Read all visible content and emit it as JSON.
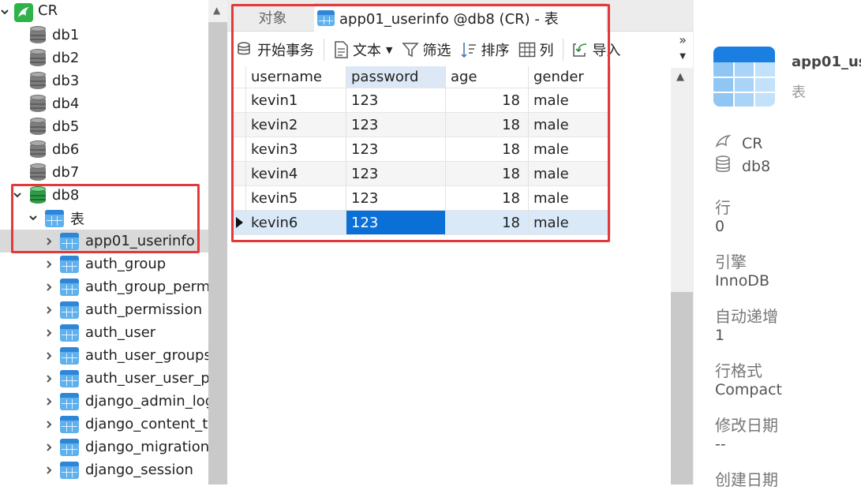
{
  "tree": {
    "connection": "CR",
    "databases": [
      "db1",
      "db2",
      "db3",
      "db4",
      "db5",
      "db6",
      "db7"
    ],
    "open_database": "db8",
    "tables_group": "表",
    "tables": [
      "app01_userinfo",
      "auth_group",
      "auth_group_perm",
      "auth_permission",
      "auth_user",
      "auth_user_groups",
      "auth_user_user_pe",
      "django_admin_log",
      "django_content_ty",
      "django_migration",
      "django_session"
    ]
  },
  "tabs": {
    "objects": "对象",
    "active": "app01_userinfo @db8 (CR) - 表"
  },
  "toolbar": {
    "begin_transaction": "开始事务",
    "text": "文本",
    "filter": "筛选",
    "sort": "排序",
    "columns": "列",
    "import": "导入"
  },
  "grid": {
    "columns": [
      "username",
      "password",
      "age",
      "gender"
    ],
    "rows": [
      [
        "kevin1",
        "123",
        "18",
        "male"
      ],
      [
        "kevin2",
        "123",
        "18",
        "male"
      ],
      [
        "kevin3",
        "123",
        "18",
        "male"
      ],
      [
        "kevin4",
        "123",
        "18",
        "male"
      ],
      [
        "kevin5",
        "123",
        "18",
        "male"
      ],
      [
        "kevin6",
        "123",
        "18",
        "male"
      ]
    ]
  },
  "info": {
    "title": "app01_us",
    "subtitle": "表",
    "connection": "CR",
    "database": "db8",
    "rows_label": "行",
    "rows_value": "0",
    "engine_label": "引擎",
    "engine_value": "InnoDB",
    "auto_inc_label": "自动递增",
    "auto_inc_value": "1",
    "row_format_label": "行格式",
    "row_format_value": "Compact",
    "modified_label": "修改日期",
    "modified_value": "--",
    "created_label": "创建日期"
  },
  "colors": {
    "highlight": "#e23a3a",
    "selection": "#0a70d8",
    "db_active": "#2e9b46"
  }
}
